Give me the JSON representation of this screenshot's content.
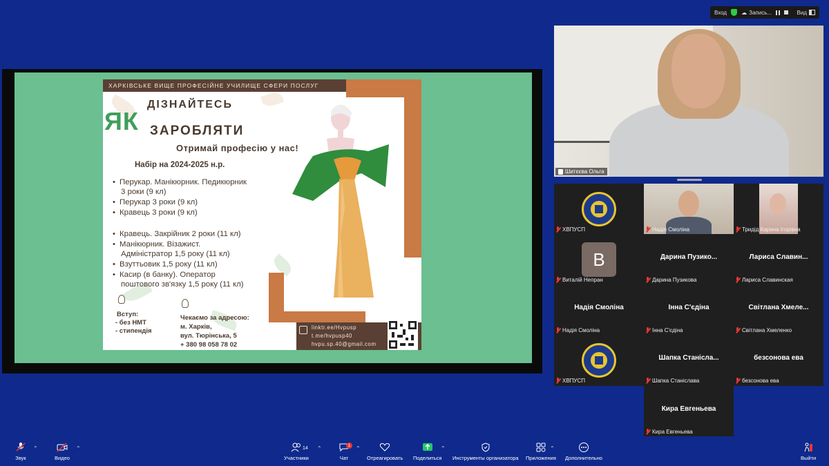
{
  "topbar": {
    "enter": "Вход",
    "record": "Запись...",
    "view": "Вид"
  },
  "slide": {
    "banner": "ХАРКІВСЬКЕ ВИЩЕ ПРОФЕСІЙНЕ УЧИЛИЩЕ СФЕРИ ПОСЛУГ",
    "yak": "ЯК",
    "learn": "ДІЗНАЙТЕСЬ",
    "earn": "ЗАРОБЛЯТИ",
    "slogan": "Отримай професію у нас!",
    "admission": "Набір на 2024-2025 н.р.",
    "list1": [
      {
        "l1": "Перукар. Манікюрник. Педикюрник",
        "l2": "3 роки (9 кл)"
      },
      {
        "l1": "Перукар 3 роки (9 кл)",
        "l2": ""
      },
      {
        "l1": "Кравець 3 роки (9 кл)",
        "l2": ""
      }
    ],
    "list2": [
      {
        "l1": "Кравець. Закрійник 2 роки (11 кл)",
        "l2": ""
      },
      {
        "l1": "Манікюрник. Візажист.",
        "l2": "Адміністратор 1,5 року (11 кл)"
      },
      {
        "l1": "Взуттьовик  1,5 року (11 кл)",
        "l2": ""
      },
      {
        "l1": "Касир (в банку). Оператор",
        "l2": "поштового зв'язку 1,5 року (11 кл)"
      }
    ],
    "entry_title": "Вступ:",
    "entry_items": [
      "-  без НМТ",
      "- стипендія"
    ],
    "address_title": "Чекаємо за адресою:",
    "address_lines": [
      "м. Харків,",
      "вул. Тюрінська, 5",
      "+ 380 98 058 78 02"
    ],
    "contacts": [
      "linktr.ee/Hvpusp",
      "t.me/hvpusp40",
      "hvpu.sp.40@gmail.com"
    ]
  },
  "main_video": {
    "name": "Шитєєва Ольга"
  },
  "gallery": [
    {
      "big": "",
      "label": "ХВПУСП",
      "type": "logo"
    },
    {
      "big": "",
      "label": "Надія Смоліна",
      "type": "photo"
    },
    {
      "big": "",
      "label": "Тридід Карина Ігорівна",
      "type": "photo"
    },
    {
      "big": "",
      "label": "Виталій Непран",
      "type": "avatar",
      "initial": "B"
    },
    {
      "big": "Дарина  Пузико...",
      "label": "Дарина Пузикова",
      "type": "name"
    },
    {
      "big": "Лариса  Славин...",
      "label": "Лариса Славинская",
      "type": "name"
    },
    {
      "big": "Надія Смоліна",
      "label": "Надія Смоліна",
      "type": "name"
    },
    {
      "big": "Інна С'єдіна",
      "label": "Інна С'єдіна",
      "type": "name"
    },
    {
      "big": "Світлана  Хмеле...",
      "label": "Світлана Хмеленко",
      "type": "name"
    },
    {
      "big": "",
      "label": "ХВПУСП",
      "type": "logo"
    },
    {
      "big": "Шапка  Станісла...",
      "label": "Шапка Станіслава",
      "type": "name"
    },
    {
      "big": "безсонова ева",
      "label": "безсонова ева",
      "type": "name"
    }
  ],
  "gallery_last": {
    "big": "Кира Евгеньева",
    "label": "Кира Евгеньева"
  },
  "toolbar": {
    "audio": "Звук",
    "video": "Видео",
    "participants": "Участники",
    "participants_count": "14",
    "chat": "Чат",
    "chat_badge": "1",
    "react": "Отреагировать",
    "share": "Поделиться",
    "host_tools": "Инструменты организатора",
    "apps": "Приложения",
    "more": "Дополнительно",
    "leave": "Выйти"
  },
  "colors": {
    "accent": "#0f2a8c",
    "slide_green": "#6bbf90",
    "poster_brown": "#5a4034",
    "poster_orange": "#c97a45",
    "mute_red": "#e53935"
  }
}
